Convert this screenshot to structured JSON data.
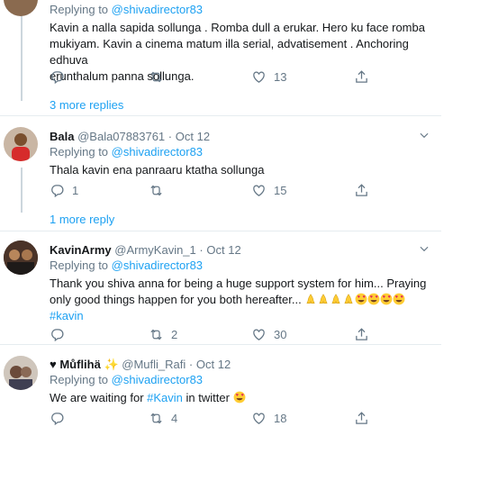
{
  "tweets": [
    {
      "reply_prefix": "Replying to",
      "reply_to": "@shivadirector83",
      "text_lines": [
        "Kavin a nalla sapida sollunga . Romba dull a erukar. Hero ku face romba",
        "mukiyam. Kavin a cinema matum illa serial, advatisement . Anchoring edhuva",
        "erunthalum panna  sollunga."
      ],
      "retweets": "",
      "likes": "13",
      "more_replies": "3 more replies"
    },
    {
      "name": "Bala",
      "handle": "@Bala07883761",
      "date": "Oct 12",
      "reply_prefix": "Replying to",
      "reply_to": "@shivadirector83",
      "text": "Thala kavin ena panraaru ktatha sollunga",
      "replies": "1",
      "retweets": "",
      "likes": "15",
      "more_replies": "1 more reply"
    },
    {
      "name": "KavinArmy",
      "handle": "@ArmyKavin_1",
      "date": "Oct 12",
      "reply_prefix": "Replying to",
      "reply_to": "@shivadirector83",
      "text_line1": "Thank you shiva anna for being a huge support system for him... Praying",
      "text_line2": "only good things happen for you both hereafter...",
      "hashtag": "#kavin",
      "retweets": "2",
      "likes": "30"
    },
    {
      "name": "Můflihä",
      "handle": "@Mufli_Rafi",
      "date": "Oct 12",
      "reply_prefix": "Replying to",
      "reply_to": "@shivadirector83",
      "text_before": "We are waiting for",
      "hashtag": "#Kavin",
      "text_after": "in twitter",
      "retweets": "4",
      "likes": "18"
    }
  ],
  "separator": "·",
  "colors": {
    "link": "#1da1f2",
    "muted": "#657786",
    "text": "#14171a",
    "thread": "#ccd6dd"
  },
  "icons": [
    "reply-icon",
    "retweet-icon",
    "like-icon",
    "share-icon",
    "chevron-down-icon",
    "heart-icon",
    "sparkle-icon"
  ]
}
